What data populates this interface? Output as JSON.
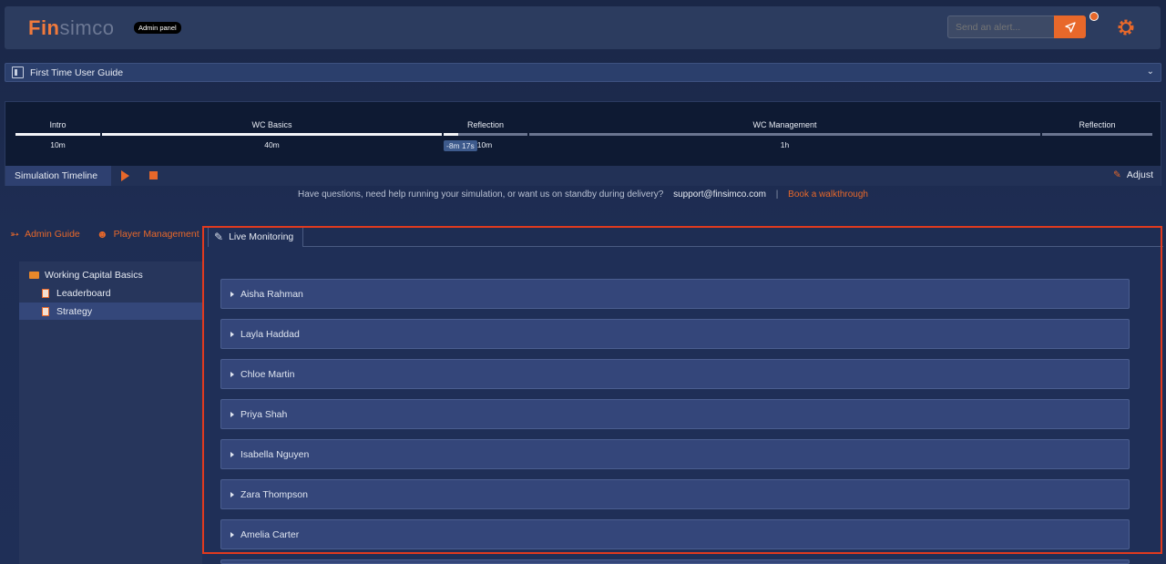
{
  "header": {
    "logo_fin": "Fin",
    "logo_simco": "simco",
    "badge": "Admin panel",
    "alert_placeholder": "Send an alert..."
  },
  "guide": {
    "title": "First Time User Guide"
  },
  "timeline": {
    "segments": [
      {
        "label": "Intro",
        "duration": "10m"
      },
      {
        "label": "WC Basics",
        "duration": "40m"
      },
      {
        "label": "Reflection",
        "duration": "10m"
      },
      {
        "label": "WC Management",
        "duration": "1h"
      },
      {
        "label": "Reflection",
        "duration": ""
      }
    ],
    "overrun": "-8m 17s",
    "label": "Simulation Timeline",
    "adjust": "Adjust"
  },
  "help": {
    "text": "Have questions, need help running your simulation, or want us on standby during delivery?",
    "email": "support@finsimco.com",
    "separator": "|",
    "link": "Book a walkthrough"
  },
  "tabs": {
    "admin_guide": "Admin Guide",
    "player_management": "Player Management",
    "live_monitoring": "Live Monitoring"
  },
  "tree": {
    "folder": "Working Capital Basics",
    "items": [
      "Leaderboard",
      "Strategy"
    ]
  },
  "players": [
    "Aisha Rahman",
    "Layla Haddad",
    "Chloe Martin",
    "Priya Shah",
    "Isabella Nguyen",
    "Zara Thompson",
    "Amelia Carter"
  ],
  "colors": {
    "accent": "#e8682a",
    "highlight": "#e03a1f"
  }
}
